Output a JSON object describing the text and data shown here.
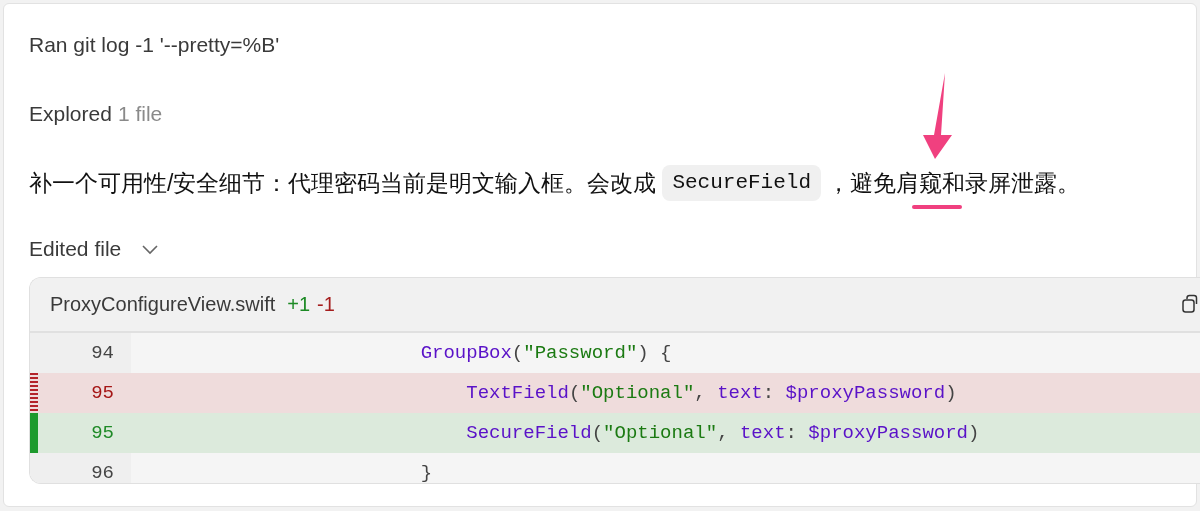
{
  "ran_command": {
    "text": "Ran git log -1 '--pretty=%B'"
  },
  "explored": {
    "label": "Explored",
    "detail": "1 file"
  },
  "note": {
    "before": "补一个可用性/安全细节：代理密码当前是明文输入框。会改成",
    "code": "SecureField",
    "after": "，避免肩窥和录屏泄露。"
  },
  "edited": {
    "label": "Edited file"
  },
  "diff": {
    "filename": "ProxyConfigureView.swift",
    "added": "+1",
    "removed": "-1",
    "lines": [
      {
        "kind": "context",
        "number": "94",
        "tokens": [
          {
            "kind": "fn",
            "s": "                        GroupBox"
          },
          {
            "kind": "p",
            "s": "("
          },
          {
            "kind": "str",
            "s": "\"Password\""
          },
          {
            "kind": "p",
            "s": ") {"
          }
        ]
      },
      {
        "kind": "removed",
        "number": "95",
        "tokens": [
          {
            "kind": "fn",
            "s": "                            TextField"
          },
          {
            "kind": "p",
            "s": "("
          },
          {
            "kind": "str",
            "s": "\"Optional\""
          },
          {
            "kind": "p",
            "s": ", "
          },
          {
            "kind": "fn",
            "s": "text"
          },
          {
            "kind": "p",
            "s": ": "
          },
          {
            "kind": "fn",
            "s": "$proxyPassword"
          },
          {
            "kind": "p",
            "s": ")"
          }
        ]
      },
      {
        "kind": "added",
        "number": "95",
        "tokens": [
          {
            "kind": "fn",
            "s": "                            SecureField"
          },
          {
            "kind": "p",
            "s": "("
          },
          {
            "kind": "str",
            "s": "\"Optional\""
          },
          {
            "kind": "p",
            "s": ", "
          },
          {
            "kind": "fn",
            "s": "text"
          },
          {
            "kind": "p",
            "s": ": "
          },
          {
            "kind": "fn",
            "s": "$proxyPassword"
          },
          {
            "kind": "p",
            "s": ")"
          }
        ]
      },
      {
        "kind": "context",
        "number": "96",
        "tokens": [
          {
            "kind": "p",
            "s": "                        }"
          }
        ]
      }
    ]
  }
}
